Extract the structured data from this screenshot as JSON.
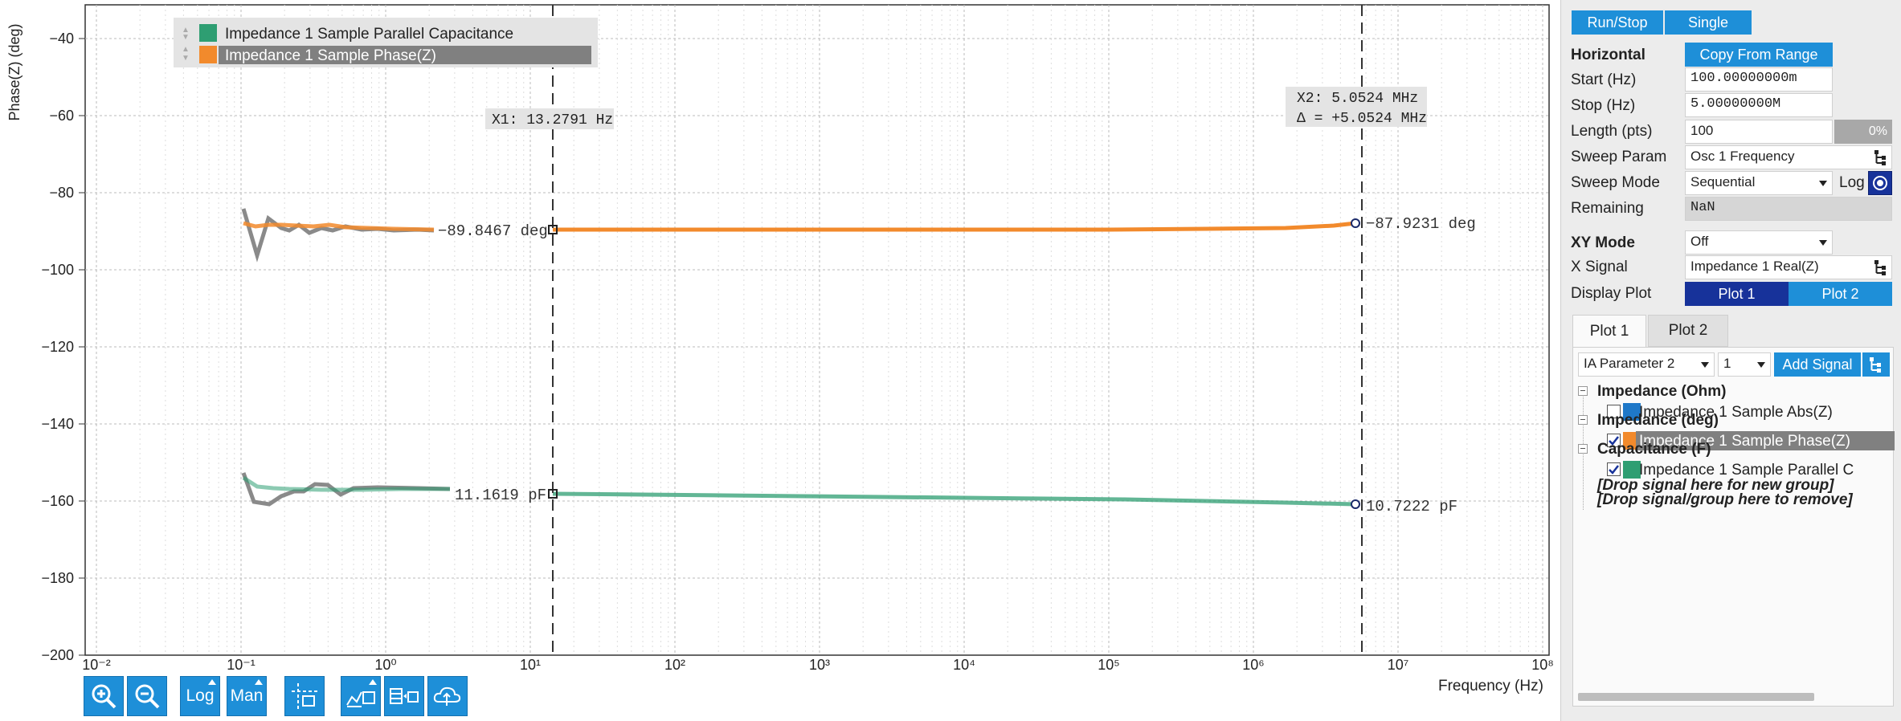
{
  "plot": {
    "y_axis_label": "Phase(Z) (deg)",
    "x_axis_label": "Frequency (Hz)",
    "y_ticks": [
      "−40",
      "−60",
      "−80",
      "−100",
      "−120",
      "−140",
      "−160",
      "−180",
      "−200"
    ],
    "x_ticks": [
      "10⁻²",
      "10⁻¹",
      "10⁰",
      "10¹",
      "10²",
      "10³",
      "10⁴",
      "10⁵",
      "10⁶",
      "10⁷",
      "10⁸"
    ],
    "legend": [
      {
        "label": "Impedance 1 Sample Parallel Capacitance",
        "color": "#2e9e72"
      },
      {
        "label": "Impedance 1 Sample Phase(Z)",
        "color": "#f28a2c"
      }
    ],
    "cursor1": {
      "label": "X1: 13.2791 Hz"
    },
    "cursor2": {
      "label1": "X2: 5.0524 MHz",
      "label2": "Δ = +5.0524 MHz"
    },
    "markers": {
      "phase_left": "−89.8467 deg",
      "phase_right": "−87.9231 deg",
      "cap_left": "11.1619 pF",
      "cap_right": "10.7222 pF"
    }
  },
  "toolbar": {
    "zoom_in_icon": "zoom-in-icon",
    "zoom_out_icon": "zoom-out-icon",
    "log_label": "Log",
    "man_label": "Man",
    "cursor_icon": "cursor-icon",
    "math_icon": "math-icon",
    "table_icon": "table-icon",
    "cloud_icon": "cloud-icon"
  },
  "panel": {
    "run_stop": "Run/Stop",
    "single": "Single",
    "horizontal": "Horizontal",
    "copy_from_range": "Copy From Range",
    "start_label": "Start (Hz)",
    "start_value": "100.00000000m",
    "stop_label": "Stop (Hz)",
    "stop_value": "5.00000000M",
    "length_label": "Length (pts)",
    "length_value": "100",
    "progress_pct": "0%",
    "progress_fraction": 0,
    "sweep_param_label": "Sweep Param",
    "sweep_param_value": "Osc 1 Frequency",
    "sweep_mode_label": "Sweep Mode",
    "sweep_mode_value": "Sequential",
    "log_label": "Log",
    "remaining_label": "Remaining",
    "remaining_value": "NaN",
    "xy_mode_label": "XY Mode",
    "xy_mode_value": "Off",
    "x_signal_label": "X Signal",
    "x_signal_value": "Impedance 1 Real(Z)",
    "display_plot_label": "Display Plot",
    "display_plot_1": "Plot 1",
    "display_plot_2": "Plot 2",
    "tab_plot1": "Plot 1",
    "tab_plot2": "Plot 2",
    "signal_select": "IA Parameter 2",
    "channel_select": "1",
    "add_signal": "Add Signal",
    "tree": {
      "group1": "Impedance (Ohm)",
      "item1": "Impedance 1 Sample Abs(Z)",
      "group2": "Impedance (deg)",
      "item2": "Impedance 1 Sample Phase(Z)",
      "group3": "Capacitance (F)",
      "item3": "Impedance 1 Sample Parallel C",
      "drop1": "[Drop signal here for new group]",
      "drop2": "[Drop signal/group here to remove]"
    },
    "colors": {
      "abs": "#1f78c8",
      "phase": "#f28a2c",
      "cap": "#2e9e72"
    }
  }
}
